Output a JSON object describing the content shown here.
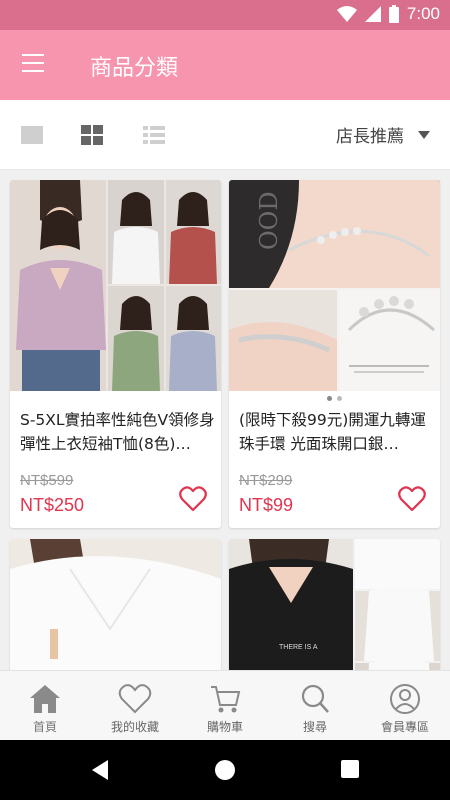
{
  "status_bar": {
    "time": "7:00",
    "color": "#d96f8c"
  },
  "header": {
    "title": "商品分類",
    "color": "#f794ae",
    "menu_icon": "hamburger-menu-icon"
  },
  "toolbar": {
    "views": [
      "single-column-view-icon",
      "grid-view-icon",
      "list-view-icon"
    ],
    "active_view": "grid",
    "sort_label": "店長推薦",
    "sort_icon": "triangle-down-icon"
  },
  "products": [
    {
      "title": "S-5XL實拍率性純色V領修身彈性上衣短袖T恤(8色)…",
      "original_price": "NT$599",
      "sale_price": "NT$250"
    },
    {
      "title": "(限時下殺99元)開運九轉運珠手環 光面珠開口銀…",
      "original_price": "NT$299",
      "sale_price": "NT$99"
    },
    {
      "title": "",
      "original_price": "",
      "sale_price": ""
    },
    {
      "title": "",
      "original_price": "",
      "sale_price": ""
    }
  ],
  "bottom_nav": [
    {
      "label": "首頁",
      "icon": "home-icon",
      "active": true
    },
    {
      "label": "我的收藏",
      "icon": "heart-icon",
      "active": false
    },
    {
      "label": "購物車",
      "icon": "cart-icon",
      "active": false
    },
    {
      "label": "搜尋",
      "icon": "search-icon",
      "active": false
    },
    {
      "label": "會員專區",
      "icon": "user-icon",
      "active": false
    }
  ],
  "colors": {
    "accent": "#f794ae",
    "price": "#e0344f",
    "heart": "#e0344f"
  }
}
